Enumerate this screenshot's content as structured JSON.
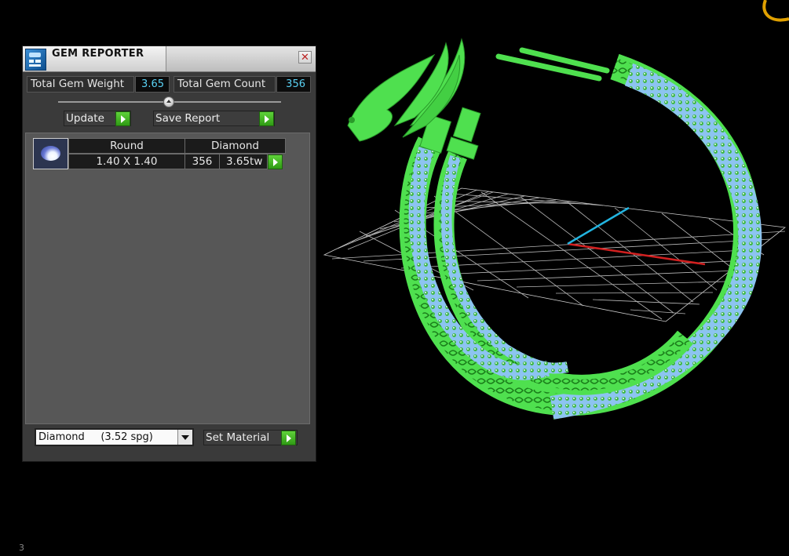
{
  "window": {
    "title": "GEM REPORTER",
    "close_symbol": "✕"
  },
  "stats": {
    "weight_label": "Total Gem Weight",
    "weight_value": "3.65",
    "count_label": "Total Gem Count",
    "count_value": "356"
  },
  "size_slider": {
    "value": 0.5
  },
  "toolbar": {
    "update_label": "Update",
    "save_label": "Save Report"
  },
  "gem_table": {
    "rows": [
      {
        "shape": "Round",
        "material": "Diamond",
        "size": "1.40 X 1.40",
        "count": "356",
        "weight": "3.65tw"
      }
    ]
  },
  "material": {
    "selected": "Diamond     (3.52 spg)",
    "set_label": "Set Material"
  },
  "viewport": {
    "model_color": "#4fe04f",
    "gem_color": "#8cc4f0",
    "grid_color": "#b8b8b8",
    "axis_x_color": "#d22020",
    "axis_y_color": "#22b4e0"
  },
  "corner_label": "3",
  "icons": [
    "app-icon",
    "close-icon",
    "gem-icon",
    "play-icon",
    "dropdown-arrow-icon"
  ]
}
